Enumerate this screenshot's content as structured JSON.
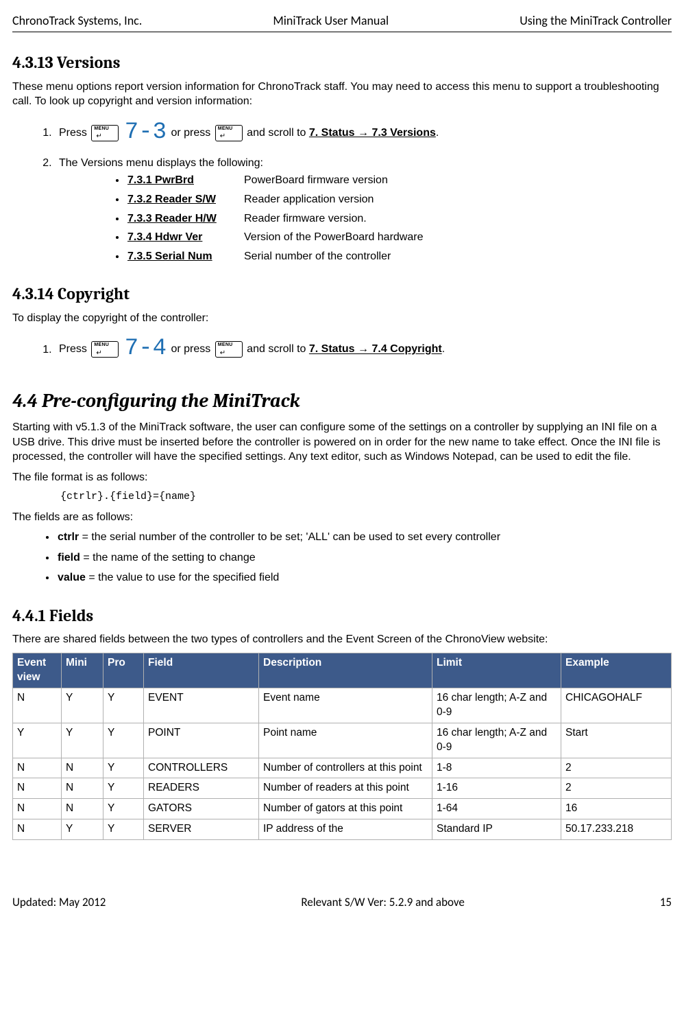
{
  "header": {
    "left": "ChronoTrack Systems, Inc.",
    "center": "MiniTrack User Manual",
    "right": "Using the MiniTrack Controller"
  },
  "sec_versions": {
    "heading": "4.3.13  Versions",
    "intro": "These menu options report version information for ChronoTrack staff.  You may need to access this menu to support a troubleshooting call. To look up copyright and version information:",
    "step1_a": "Press ",
    "step1_digits": "7-3",
    "step1_b": " or press ",
    "step1_c": " and scroll to ",
    "step1_path": "7. Status → 7.3 Versions",
    "step1_dot": ".",
    "step2": "The Versions menu displays the following:",
    "items": [
      {
        "label": "7.3.1 PwrBrd",
        "desc": "PowerBoard firmware version"
      },
      {
        "label": "7.3.2 Reader S/W",
        "desc": "Reader application version"
      },
      {
        "label": "7.3.3 Reader H/W",
        "desc": "Reader firmware version."
      },
      {
        "label": "7.3.4 Hdwr Ver",
        "desc": "Version of the PowerBoard hardware"
      },
      {
        "label": "7.3.5 Serial Num",
        "desc": "Serial number of the controller"
      }
    ]
  },
  "sec_copyright": {
    "heading": "4.3.14  Copyright",
    "intro": "To display the copyright of the controller:",
    "step1_a": "Press ",
    "step1_digits": "7-4",
    "step1_b": " or press ",
    "step1_c": " and scroll to ",
    "step1_path": "7. Status → 7.4 Copyright",
    "step1_dot": "."
  },
  "sec_preconfig": {
    "heading": "4.4     Pre-configuring the MiniTrack",
    "p1": "Starting with v5.1.3 of the MiniTrack software, the user can configure some of the settings on a controller by supplying an INI file on a USB drive.  This drive must be inserted before the controller is powered on in order for the new name to take effect.  Once the INI file is processed, the controller will have the specified settings.  Any text editor, such as Windows Notepad, can be used to edit the file.",
    "p2": "The file format is as follows:",
    "code": "{ctrlr}.{field}={name}",
    "p3": "The fields are as follows:",
    "defs": [
      {
        "name": "ctrlr",
        "after": "  = the serial number of the controller to be set; 'ALL' can be used to set every controller"
      },
      {
        "name": "field",
        "after": " = the name of the setting to change"
      },
      {
        "name": "value",
        "after": " = the value to use for the specified field"
      }
    ]
  },
  "sec_fields": {
    "heading": "4.4.1  Fields",
    "intro": "There are shared fields between the two types of controllers and the Event Screen of the ChronoView website:",
    "headers": [
      "Event view",
      "Mini",
      "Pro",
      "Field",
      "Description",
      "Limit",
      "Example"
    ],
    "rows": [
      [
        "N",
        "Y",
        "Y",
        "EVENT",
        "Event name",
        "16 char length; A-Z and 0-9",
        "CHICAGOHALF"
      ],
      [
        "Y",
        "Y",
        "Y",
        "POINT",
        "Point name",
        "16 char length; A-Z and 0-9",
        "Start"
      ],
      [
        "N",
        "N",
        "Y",
        "CONTROLLERS",
        "Number of controllers at this point",
        "1-8",
        "2"
      ],
      [
        "N",
        "N",
        "Y",
        "READERS",
        "Number of readers at this point",
        "1-16",
        "2"
      ],
      [
        "N",
        "N",
        "Y",
        "GATORS",
        "Number of gators at this point",
        "1-64",
        "16"
      ],
      [
        "N",
        "Y",
        "Y",
        "SERVER",
        "IP address of the",
        "Standard IP",
        "50.17.233.218"
      ]
    ]
  },
  "footer": {
    "left": "Updated: May 2012",
    "center": "Relevant S/W Ver: 5.2.9 and above",
    "right": "15"
  }
}
